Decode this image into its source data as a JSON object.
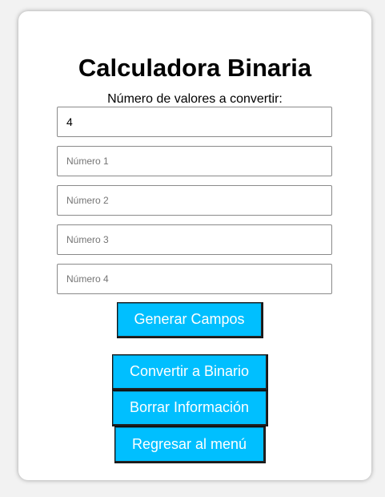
{
  "title": "Calculadora Binaria",
  "count_label": "Número de valores a convertir:",
  "count_value": "4",
  "fields": [
    {
      "placeholder": "Número 1"
    },
    {
      "placeholder": "Número 2"
    },
    {
      "placeholder": "Número 3"
    },
    {
      "placeholder": "Número 4"
    }
  ],
  "buttons": {
    "generate": "Generar Campos",
    "convert": "Convertir a Binario",
    "clear": "Borrar Información",
    "back": "Regresar al menú"
  },
  "colors": {
    "button_bg": "#00bfff",
    "button_text": "#ffffff"
  }
}
